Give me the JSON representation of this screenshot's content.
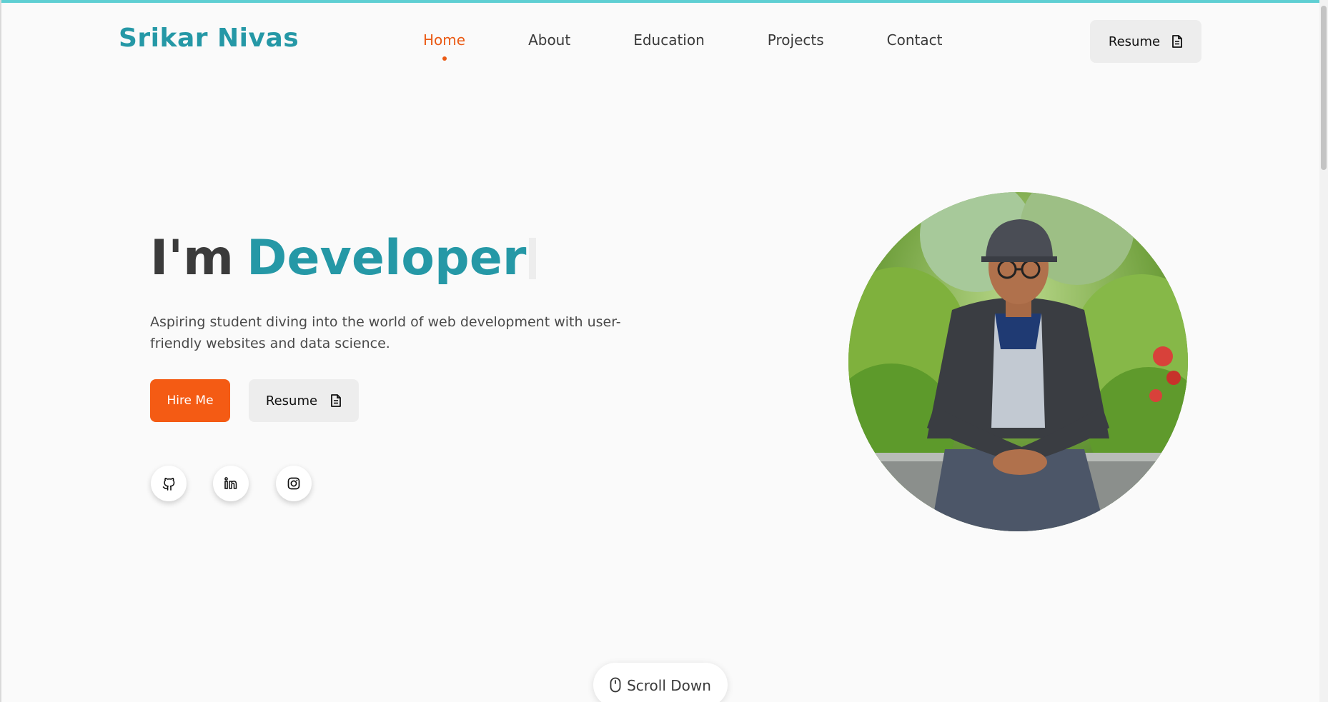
{
  "header": {
    "logo": "Srikar Nivas",
    "nav": [
      {
        "label": "Home",
        "active": true
      },
      {
        "label": "About",
        "active": false
      },
      {
        "label": "Education",
        "active": false
      },
      {
        "label": "Projects",
        "active": false
      },
      {
        "label": "Contact",
        "active": false
      }
    ],
    "resume_label": "Resume",
    "resume_icon": "document-icon"
  },
  "hero": {
    "title_prefix": "I'm",
    "title_accent": "Developer",
    "description": "Aspiring student diving into the world of web development with user-friendly websites and data science.",
    "hire_label": "Hire Me",
    "resume_label": "Resume",
    "socials": [
      {
        "name": "github-icon"
      },
      {
        "name": "linkedin-icon"
      },
      {
        "name": "instagram-icon"
      }
    ]
  },
  "scroll": {
    "label": "Scroll Down",
    "icon": "mouse-icon"
  },
  "colors": {
    "accent": "#2598a6",
    "primary_orange": "#f45b14",
    "top_border": "#5fcfd3"
  }
}
